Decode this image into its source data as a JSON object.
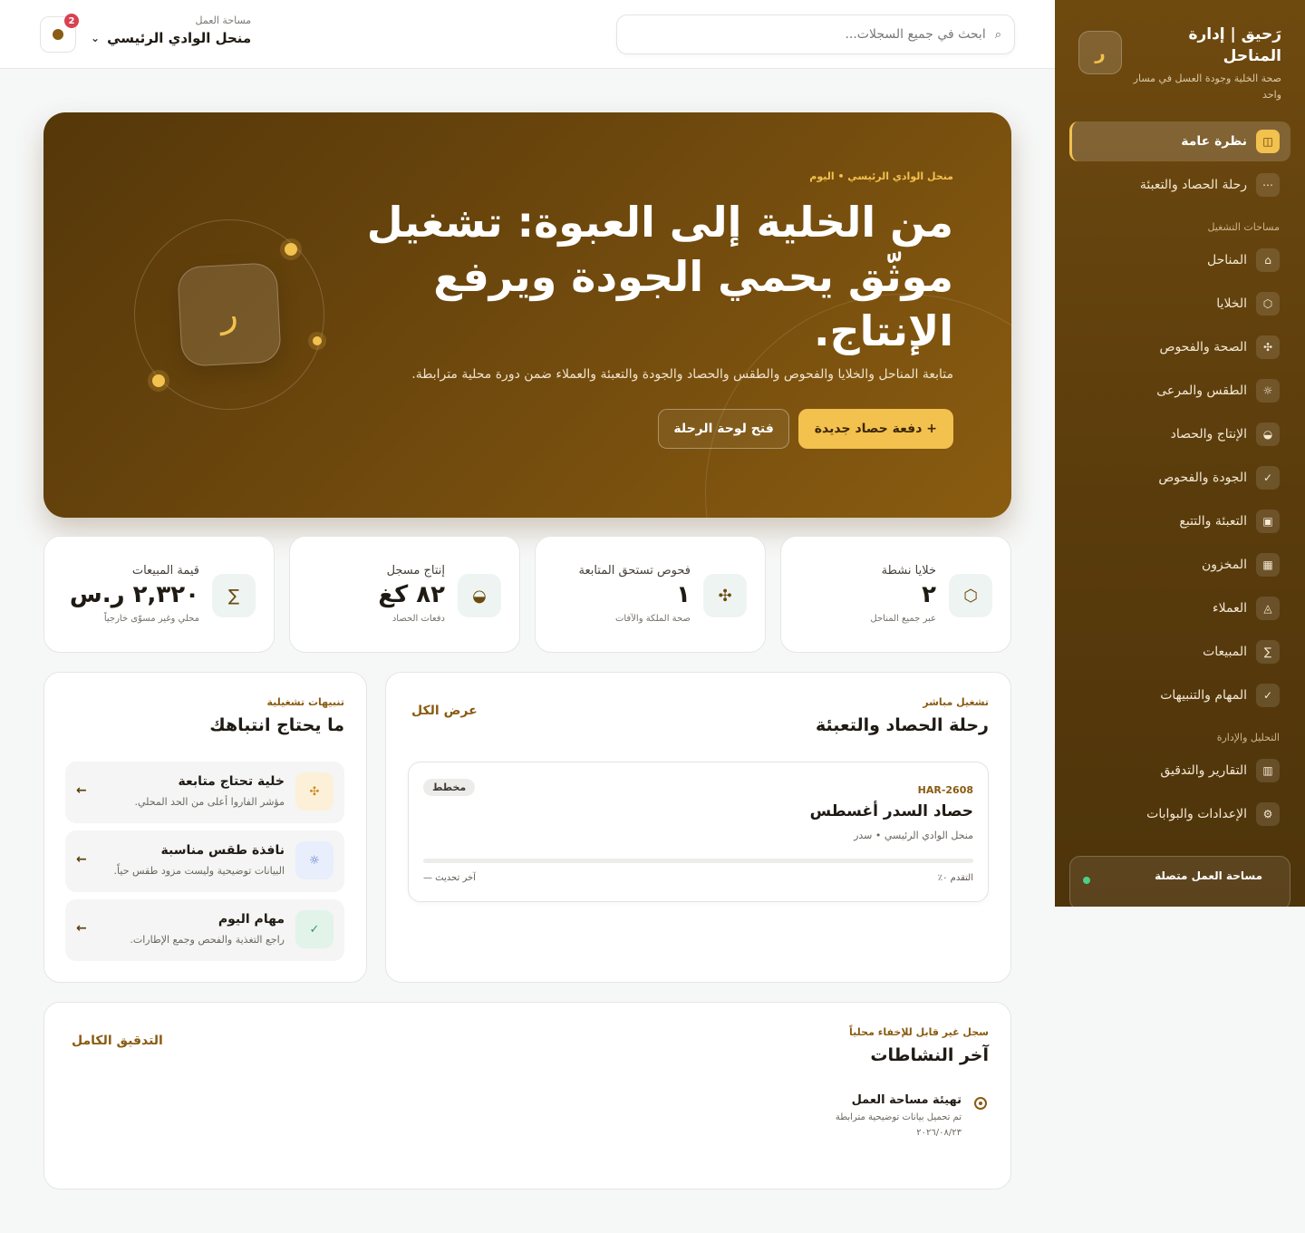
{
  "brand": {
    "logo_letter": "ر",
    "title": "رَحيق | إدارة المناحل",
    "subtitle": "صحة الخلية وجودة العسل في مسار واحد"
  },
  "sidebar": {
    "main_items": [
      {
        "label": "نظرة عامة",
        "icon": "grid-icon",
        "glyph": "◫",
        "active": true
      },
      {
        "label": "رحلة الحصاد والتعبئة",
        "icon": "route-icon",
        "glyph": "⋯",
        "active": false
      }
    ],
    "section_ops": "مساحات التشغيل",
    "ops_items": [
      {
        "label": "المناحل",
        "icon": "apiary-icon",
        "glyph": "⌂"
      },
      {
        "label": "الخلايا",
        "icon": "hive-icon",
        "glyph": "⬡"
      },
      {
        "label": "الصحة والفحوص",
        "icon": "health-icon",
        "glyph": "✣"
      },
      {
        "label": "الطقس والمرعى",
        "icon": "sun-icon",
        "glyph": "☼"
      },
      {
        "label": "الإنتاج والحصاد",
        "icon": "harvest-icon",
        "glyph": "◒"
      },
      {
        "label": "الجودة والفحوص",
        "icon": "check-icon",
        "glyph": "✓"
      },
      {
        "label": "التعبئة والتتبع",
        "icon": "package-icon",
        "glyph": "▣"
      },
      {
        "label": "المخزون",
        "icon": "inventory-icon",
        "glyph": "▦"
      },
      {
        "label": "العملاء",
        "icon": "customers-icon",
        "glyph": "◬"
      },
      {
        "label": "المبيعات",
        "icon": "sigma-icon",
        "glyph": "∑"
      },
      {
        "label": "المهام والتنبيهات",
        "icon": "tasks-icon",
        "glyph": "✓"
      }
    ],
    "section_admin": "التحليل والإدارة",
    "admin_items": [
      {
        "label": "التقارير والتدقيق",
        "icon": "reports-icon",
        "glyph": "▥"
      },
      {
        "label": "الإعدادات والبوابات",
        "icon": "settings-icon",
        "glyph": "⚙"
      }
    ],
    "status": "مساحة العمل متصلة"
  },
  "topbar": {
    "search_placeholder": "ابحث في جميع السجلات...",
    "workspace_label": "مساحة العمل",
    "workspace_name": "منحل الوادي الرئيسي",
    "notifications_count": "2"
  },
  "hero": {
    "kicker": "منحل الوادي الرئيسي • اليوم",
    "title": "من الخلية إلى العبوة: تشغيل موثّق يحمي الجودة ويرفع الإنتاج.",
    "description": "متابعة المناحل والخلايا والفحوص والطقس والحصاد والجودة والتعبئة والعملاء ضمن دورة محلية مترابطة.",
    "primary_action": "+ دفعة حصاد جديدة",
    "secondary_action": "فتح لوحة الرحلة",
    "logo_letter": "ر"
  },
  "stats": [
    {
      "label": "خلايا نشطة",
      "value": "٢",
      "sub": "عبر جميع المناحل",
      "icon": "hive-icon",
      "glyph": "⬡"
    },
    {
      "label": "فحوص تستحق المتابعة",
      "value": "١",
      "sub": "صحة الملكة والآفات",
      "icon": "health-icon",
      "glyph": "✣"
    },
    {
      "label": "إنتاج مسجل",
      "value": "٨٢ كغ",
      "sub": "دفعات الحصاد",
      "icon": "harvest-icon",
      "glyph": "◒"
    },
    {
      "label": "قيمة المبيعات",
      "value": "٢,٣٢٠ ر.س",
      "sub": "محلي وغير مسوّى خارجياً",
      "icon": "sigma-icon",
      "glyph": "∑"
    }
  ],
  "journey": {
    "kicker": "تشغيل مباشر",
    "title": "رحلة الحصاد والتعبئة",
    "view_all": "عرض الكل",
    "batch": {
      "code": "HAR-2608",
      "name": "حصاد السدر أغسطس",
      "meta": "منحل الوادي الرئيسي • سدر",
      "tag": "مخطط",
      "progress_label": "التقدم ٠٪",
      "progress_value": 0,
      "updated_label": "آخر تحديث —"
    }
  },
  "alerts": {
    "kicker": "تنبيهات تشغيلية",
    "title": "ما يحتاج انتباهك",
    "items": [
      {
        "title": "خلية تحتاج متابعة",
        "desc": "مؤشر الفاروا أعلى من الحد المحلي.",
        "icon": "mite-icon",
        "glyph": "✣",
        "bg": "#fdf0d8",
        "fg": "#c78a1e"
      },
      {
        "title": "نافذة طقس مناسبة",
        "desc": "البيانات توضيحية وليست مزود طقس حياً.",
        "icon": "sun-icon",
        "glyph": "☼",
        "bg": "#e8eefb",
        "fg": "#4a6fc4"
      },
      {
        "title": "مهام اليوم",
        "desc": "راجع التغذية والفحص وجمع الإطارات.",
        "icon": "check-icon",
        "glyph": "✓",
        "bg": "#e2f3ea",
        "fg": "#2f9a62"
      }
    ]
  },
  "activity": {
    "kicker": "سجل غير قابل للإخفاء محلياً",
    "title": "آخر النشاطات",
    "audit_link": "التدقيق الكامل",
    "items": [
      {
        "title": "تهيئة مساحة العمل",
        "desc": "تم تحميل بيانات توضيحية مترابطة",
        "time": "٢٠٢٦/٠٨/٢٣"
      }
    ]
  }
}
